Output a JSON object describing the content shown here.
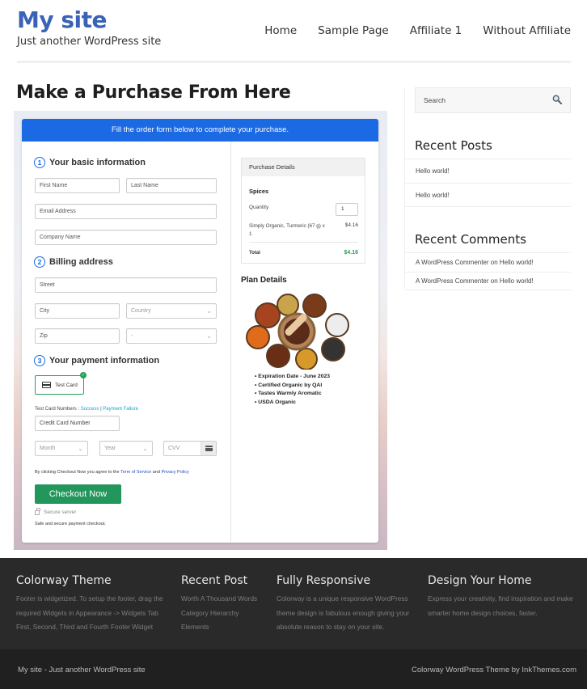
{
  "site": {
    "title": "My site",
    "tagline": "Just another WordPress site",
    "brand_color": "#3a63b8"
  },
  "nav": {
    "items": [
      {
        "label": "Home"
      },
      {
        "label": "Sample Page"
      },
      {
        "label": "Affiliate 1"
      },
      {
        "label": "Without Affiliate"
      }
    ]
  },
  "page": {
    "title": "Make a Purchase From Here"
  },
  "form": {
    "banner": "Fill the order form below to complete your purchase.",
    "banner_color": "#1b6ae3",
    "steps": [
      {
        "num": "1",
        "title": "Your basic information"
      },
      {
        "num": "2",
        "title": "Billing address"
      },
      {
        "num": "3",
        "title": "Your payment information"
      }
    ],
    "fields": {
      "first_name": "First Name",
      "last_name": "Last Name",
      "email": "Email Address",
      "company": "Company Name",
      "street": "Street",
      "city": "City",
      "country": "Country",
      "zip": "Zip",
      "state": "-",
      "credit_card": "Credit Card Number",
      "month": "Month",
      "year": "Year",
      "cvv": "CVV"
    },
    "payment_method": "Test Card",
    "test_card_label": "Test Card Numbers :",
    "test_card_success": "Success",
    "test_card_separator": "|",
    "test_card_failure": "Payment Failure",
    "agree_prefix": "By clicking Checkout Now you agree to the",
    "terms_link": "Term of Service",
    "agree_and": "and",
    "privacy_link": "Privacy Policy",
    "checkout_button": "Checkout Now",
    "checkout_color": "#22965b",
    "secure_label": "Secure server",
    "safe_label": "Safe and secure payment checkout."
  },
  "purchase": {
    "header": "Purchase Details",
    "product": "Spices",
    "quantity_label": "Quantity",
    "quantity": "1",
    "item_name": "Simply Organic, Turmeric (67 g) x 1",
    "item_price": "$4.16",
    "total_label": "Total",
    "total_price": "$4.16"
  },
  "plan": {
    "title": "Plan Details",
    "features": [
      "Expiration Date - June 2023",
      "Certified Organic by QAI",
      "Tastes Warmly Aromatic",
      "USDA Organic"
    ]
  },
  "sidebar": {
    "search_placeholder": "Search",
    "recent_posts_title": "Recent Posts",
    "recent_posts": [
      "Hello world!",
      "Hello world!"
    ],
    "recent_comments_title": "Recent Comments",
    "recent_comments": [
      "A WordPress Commenter on Hello world!",
      "A WordPress Commenter on Hello world!"
    ]
  },
  "footer": {
    "columns": [
      {
        "title": "Colorway Theme",
        "lines": [
          "Footer is widgetized. To setup the footer, drag the",
          "required Widgets in Appearance -> Widgets Tab",
          "First, Second, Third and Fourth Footer Widget"
        ]
      },
      {
        "title": "Recent Post",
        "lines": [
          "Worth A Thousand Words",
          "Category Hierarchy",
          "Elements"
        ]
      },
      {
        "title": "Fully Responsive",
        "lines": [
          "Colorway is a unique responsive WordPress",
          "theme design is fabulous enough giving your",
          "absolute reason to stay on your site."
        ]
      },
      {
        "title": "Design Your Home",
        "lines": [
          "Express your creativity, find inspiration and make",
          "smarter home design choices, faster."
        ]
      }
    ],
    "bottom_left": "My site - Just another WordPress site",
    "bottom_right": "Colorway WordPress Theme by InkThemes.com"
  }
}
